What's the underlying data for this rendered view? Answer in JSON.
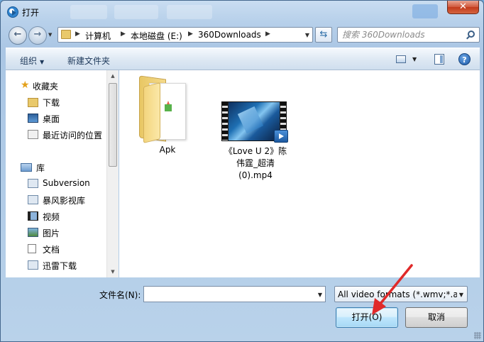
{
  "window": {
    "title": "打开"
  },
  "address": {
    "crumbs": [
      "计算机",
      "本地磁盘 (E:)",
      "360Downloads"
    ]
  },
  "search": {
    "placeholder": "搜索 360Downloads"
  },
  "toolbar": {
    "organize": "组织",
    "new_folder": "新建文件夹"
  },
  "navpane": {
    "favorites": {
      "label": "收藏夹",
      "items": [
        {
          "label": "下载",
          "icon": "download-folder-icon"
        },
        {
          "label": "桌面",
          "icon": "desktop-icon"
        },
        {
          "label": "最近访问的位置",
          "icon": "recent-places-icon"
        }
      ]
    },
    "libraries": {
      "label": "库",
      "items": [
        {
          "label": "Subversion",
          "icon": "library-icon"
        },
        {
          "label": "暴风影视库",
          "icon": "library-icon"
        },
        {
          "label": "视频",
          "icon": "video-library-icon"
        },
        {
          "label": "图片",
          "icon": "picture-library-icon"
        },
        {
          "label": "文档",
          "icon": "document-library-icon"
        },
        {
          "label": "迅雷下载",
          "icon": "library-icon"
        }
      ]
    }
  },
  "files": [
    {
      "name": "Apk",
      "type": "folder"
    },
    {
      "name_lines": [
        "《Love U 2》陈",
        "伟霆_超清",
        "(0).mp4"
      ],
      "type": "video"
    }
  ],
  "footer": {
    "filename_label": "文件名(N):",
    "filename_value": "",
    "filter_value": "All video formats (*.wmv;*.av",
    "open_label": "打开(O)",
    "cancel_label": "取消"
  },
  "colors": {
    "annotation_arrow": "#e02a2a",
    "accent": "#3c7fb1"
  }
}
